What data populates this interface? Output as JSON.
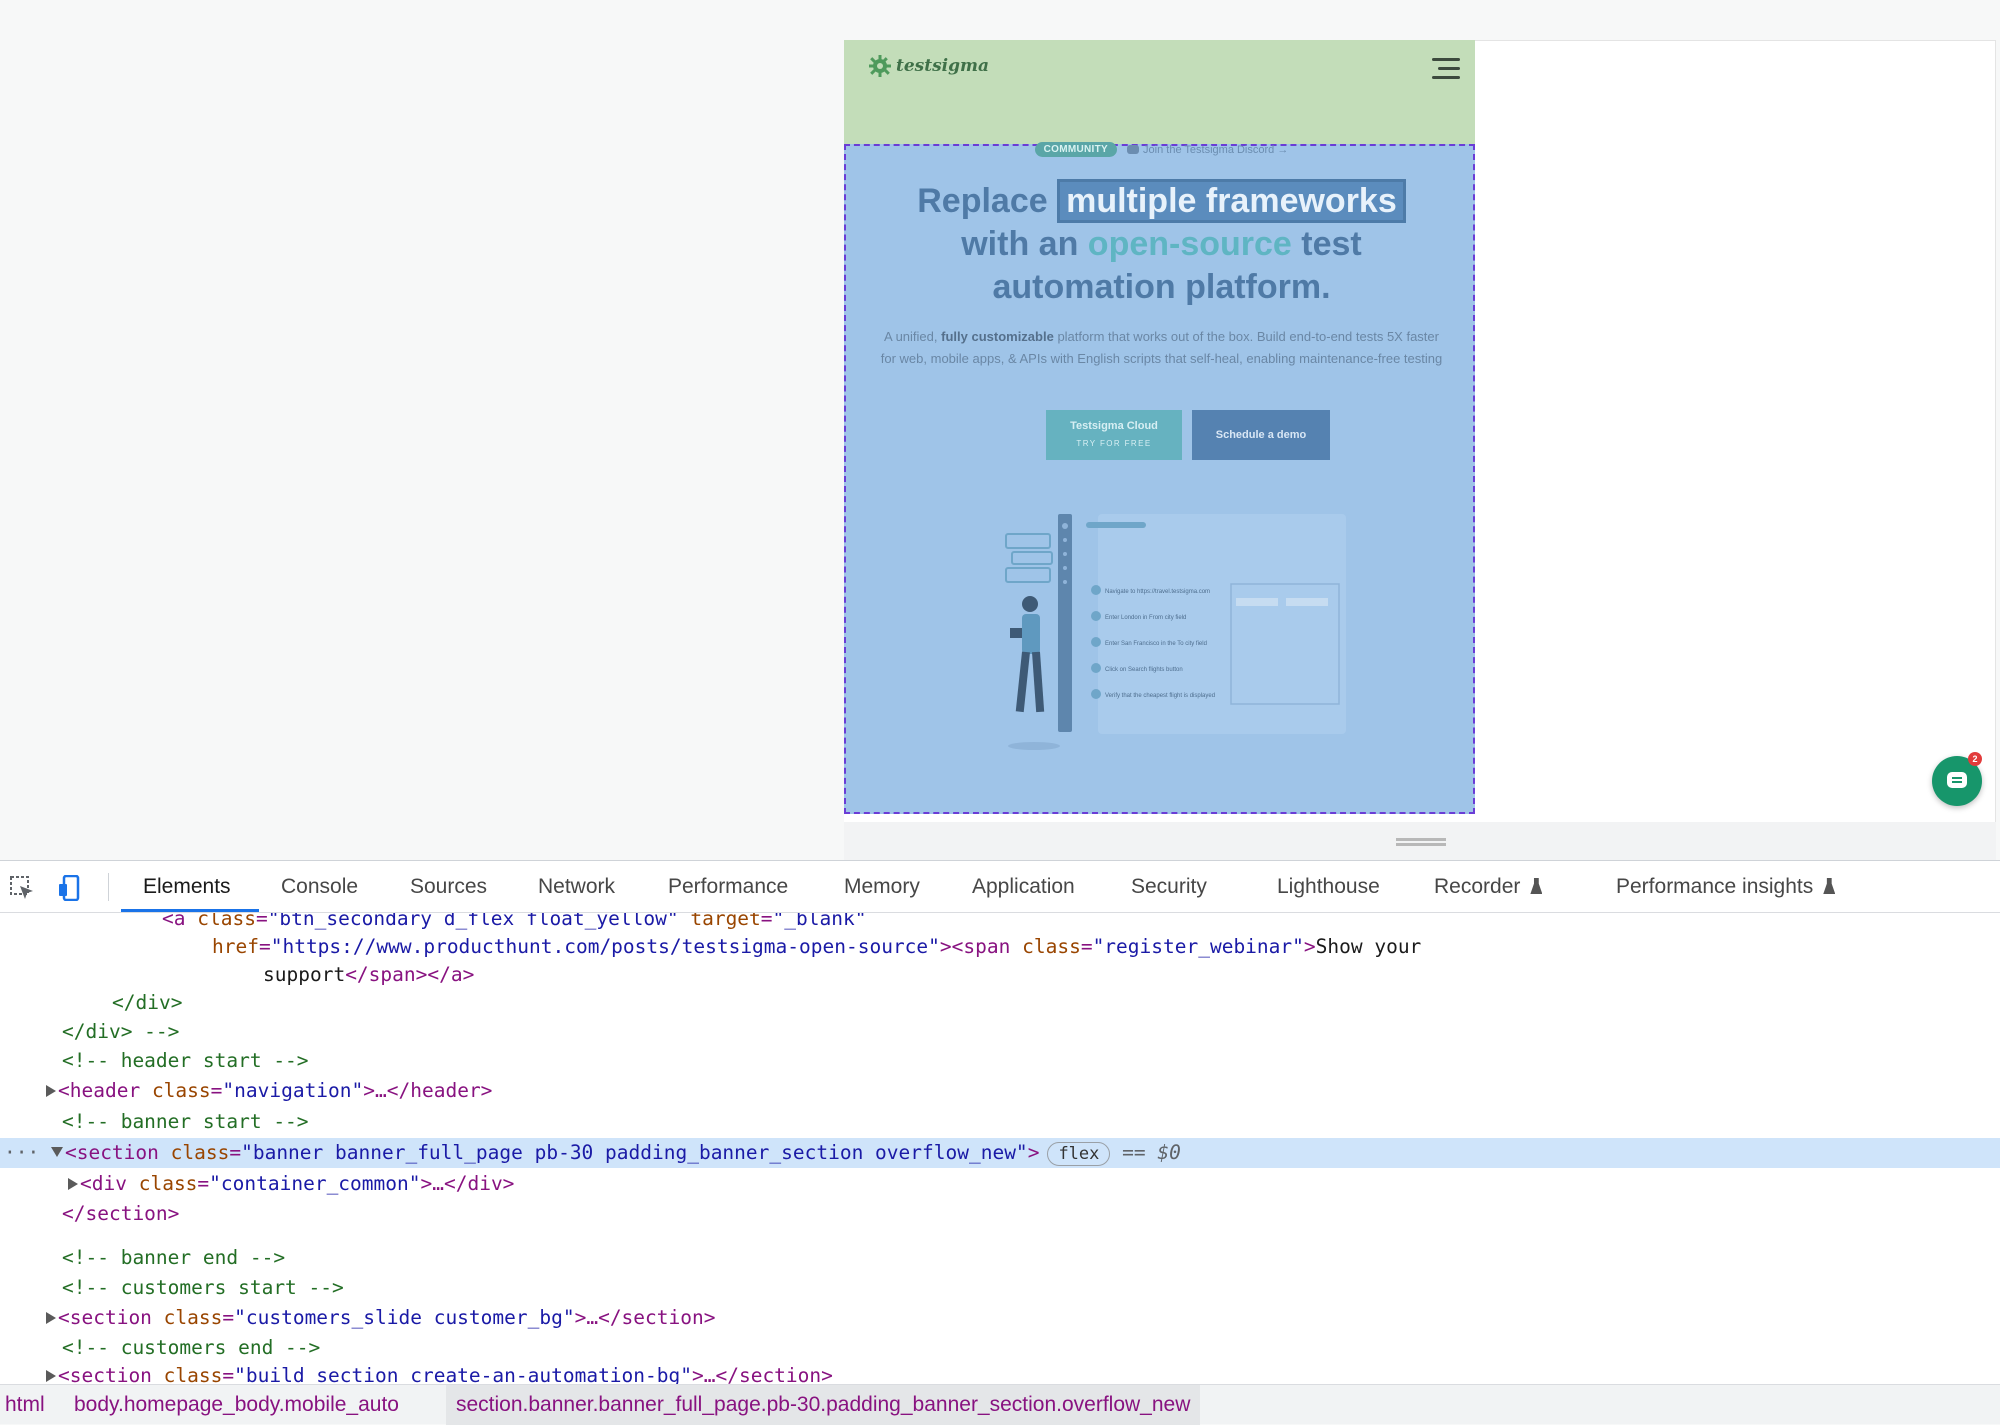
{
  "site": {
    "logo_text": "testsigma",
    "community_badge": "COMMUNITY",
    "discord_link": "Join the Testsigma Discord →",
    "headline": {
      "part1": "Replace ",
      "highlight": "multiple frameworks",
      "part2": "with an ",
      "teal": "open-source",
      "part3": " test automation platform."
    },
    "sub_text": {
      "part1": "A unified, ",
      "bold": "fully customizable",
      "part2": " platform that works out of the box. Build end-to-end tests 5X faster for web, mobile apps, & APIs with English scripts that self-heal, enabling maintenance-free testing"
    },
    "btn_cloud": {
      "label": "Testsigma Cloud",
      "sub": "TRY FOR FREE"
    },
    "btn_demo": "Schedule a demo",
    "illustration_steps": [
      "Navigate to https://travel.testsigma.com",
      "Enter London in From city field",
      "Enter San Francisco in the To city field",
      "Click on Search flights button",
      "Verify that the cheapest flight is displayed"
    ],
    "colors": {
      "header_highlight": "#c3ddb9",
      "banner_highlight": "#9fc4e8",
      "brand_green": "#3f7048",
      "chat_green": "#17966b"
    }
  },
  "chat_widget": {
    "badge": "2"
  },
  "devtools": {
    "tabs": [
      {
        "label": "Elements",
        "active": true
      },
      {
        "label": "Console"
      },
      {
        "label": "Sources"
      },
      {
        "label": "Network"
      },
      {
        "label": "Performance"
      },
      {
        "label": "Memory"
      },
      {
        "label": "Application"
      },
      {
        "label": "Security"
      },
      {
        "label": "Lighthouse"
      },
      {
        "label": "Recorder",
        "experimental": true
      },
      {
        "label": "Performance insights",
        "experimental": true
      }
    ],
    "dom": {
      "l1_a": "<a",
      "l1_class_attr": "class",
      "l1_class_val": "\"btn_secondary d_flex float_yellow\"",
      "l1_target_attr": "target",
      "l1_target_val": "\"_blank\"",
      "l2_href_attr": "href",
      "l2_href_val": "\"https://www.producthunt.com/posts/testsigma-open-source\"",
      "l2_span_open": "><span",
      "l2_span_class_attr": "class",
      "l2_span_class_val": "\"register_webinar\"",
      "l2_text": "Show your",
      "l3_text": "support",
      "l3_close": "</span></a>",
      "l4": "</div>",
      "l5": "</div> -->",
      "l6": "<!-- header start -->",
      "l7_open": "<header",
      "l7_attr": "class",
      "l7_val": "\"navigation\"",
      "l7_close": ">…</header>",
      "l8": "<!-- banner start -->",
      "l9_open": "<section",
      "l9_attr": "class",
      "l9_val": "\"banner banner_full_page pb-30 padding_banner_section overflow_new\"",
      "l9_close": ">",
      "l9_pill": "flex",
      "l9_eq": "== ",
      "l9_dollar": "$0",
      "l10_open": "<div",
      "l10_attr": "class",
      "l10_val": "\"container_common\"",
      "l10_close": ">…</div>",
      "l11": "</section>",
      "l12": "<!-- banner end -->",
      "l13": "<!-- customers start -->",
      "l14_open": "<section",
      "l14_attr": "class",
      "l14_val": "\"customers_slide customer_bg\"",
      "l14_close": ">…</section>",
      "l15": "<!-- customers end -->",
      "l16_open": "<section",
      "l16_attr": "class",
      "l16_val": "\"build_section create-an-automation-bg\"",
      "l16_close": ">…</section>"
    },
    "breadcrumbs": [
      "html",
      "body.homepage_body.mobile_auto",
      "section.banner.banner_full_page.pb-30.padding_banner_section.overflow_new"
    ]
  }
}
